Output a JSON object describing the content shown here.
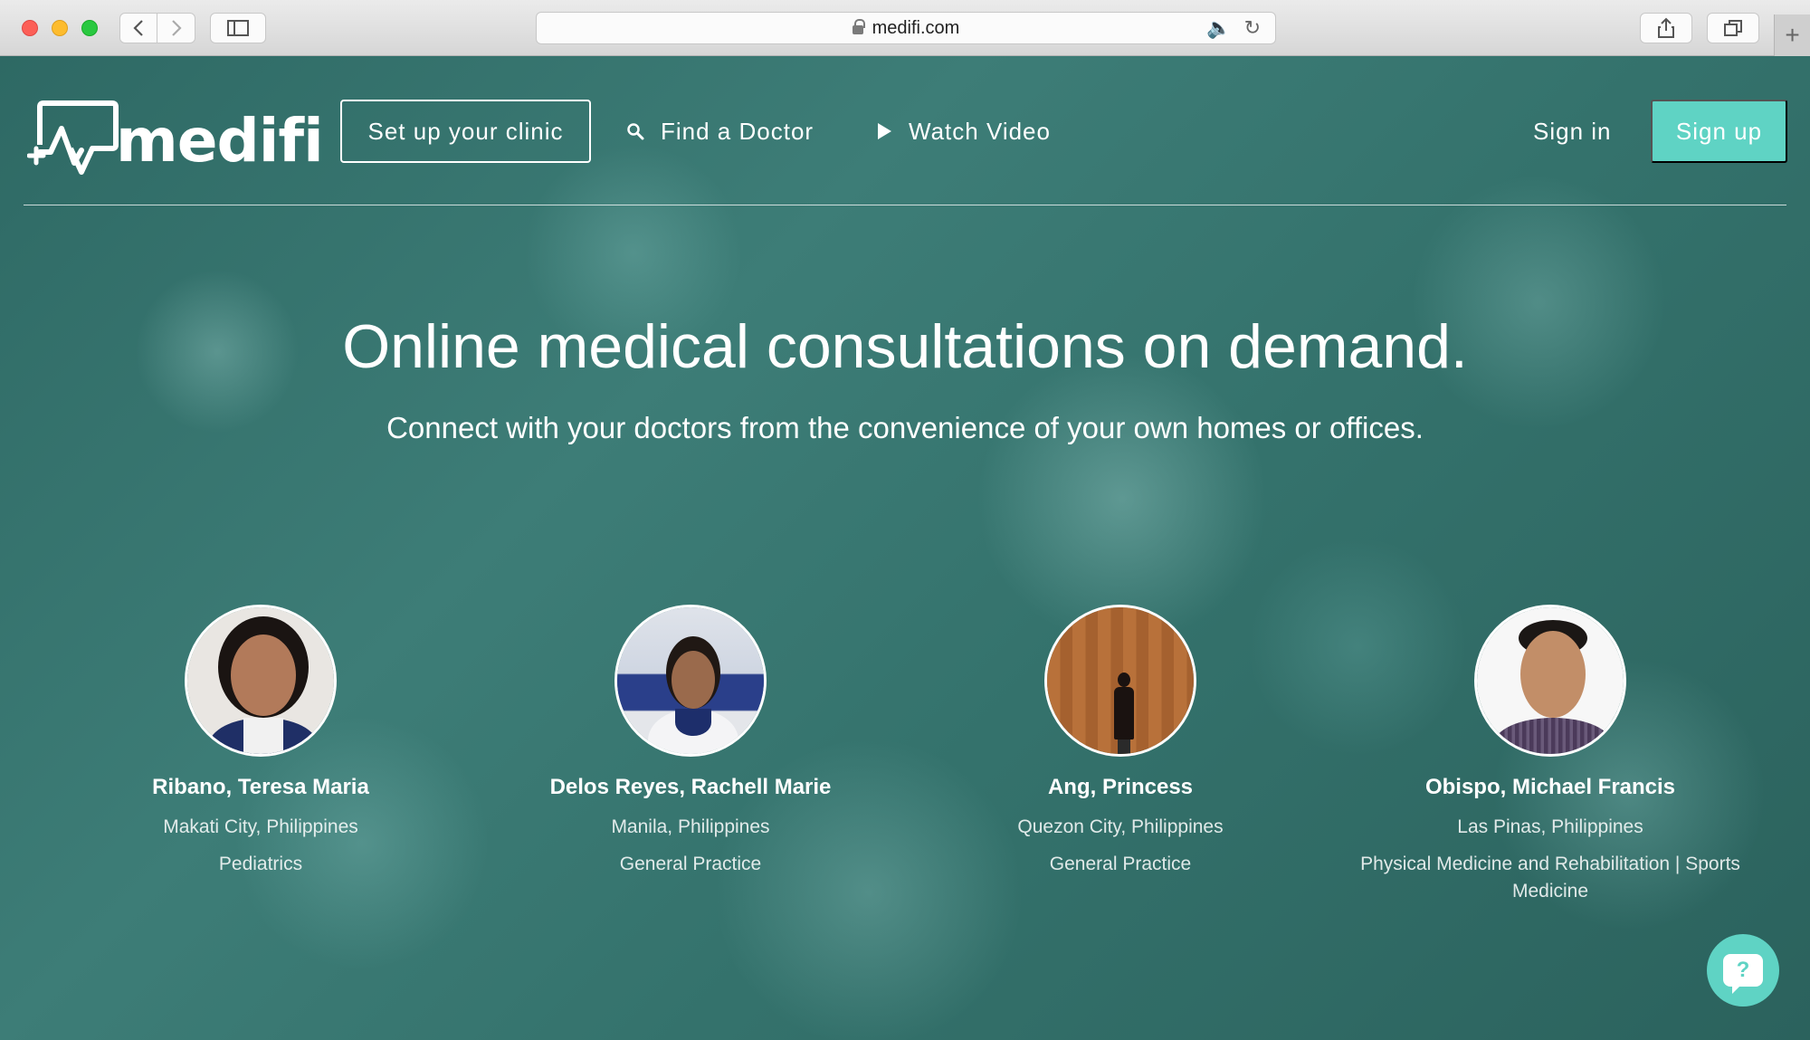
{
  "browser": {
    "url": "medifi.com",
    "new_tab_label": "+"
  },
  "header": {
    "logo_text": "medifi",
    "setup_clinic": "Set up your clinic",
    "find_doctor": "Find a Doctor",
    "watch_video": "Watch Video",
    "sign_in": "Sign in",
    "sign_up": "Sign up"
  },
  "hero": {
    "title": "Online medical consultations on demand.",
    "subtitle": "Connect with your doctors from the convenience of your own homes or offices."
  },
  "doctors": [
    {
      "name": "Ribano, Teresa Maria",
      "location": "Makati City, Philippines",
      "specialty": "Pediatrics"
    },
    {
      "name": "Delos Reyes, Rachell Marie",
      "location": "Manila, Philippines",
      "specialty": "General Practice"
    },
    {
      "name": "Ang, Princess",
      "location": "Quezon City, Philippines",
      "specialty": "General Practice"
    },
    {
      "name": "Obispo, Michael Francis",
      "location": "Las Pinas, Philippines",
      "specialty": "Physical Medicine and Rehabilitation | Sports Medicine"
    }
  ],
  "help": {
    "icon_text": "?"
  },
  "colors": {
    "accent": "#5fd3c4",
    "background": "#2f6b66"
  }
}
